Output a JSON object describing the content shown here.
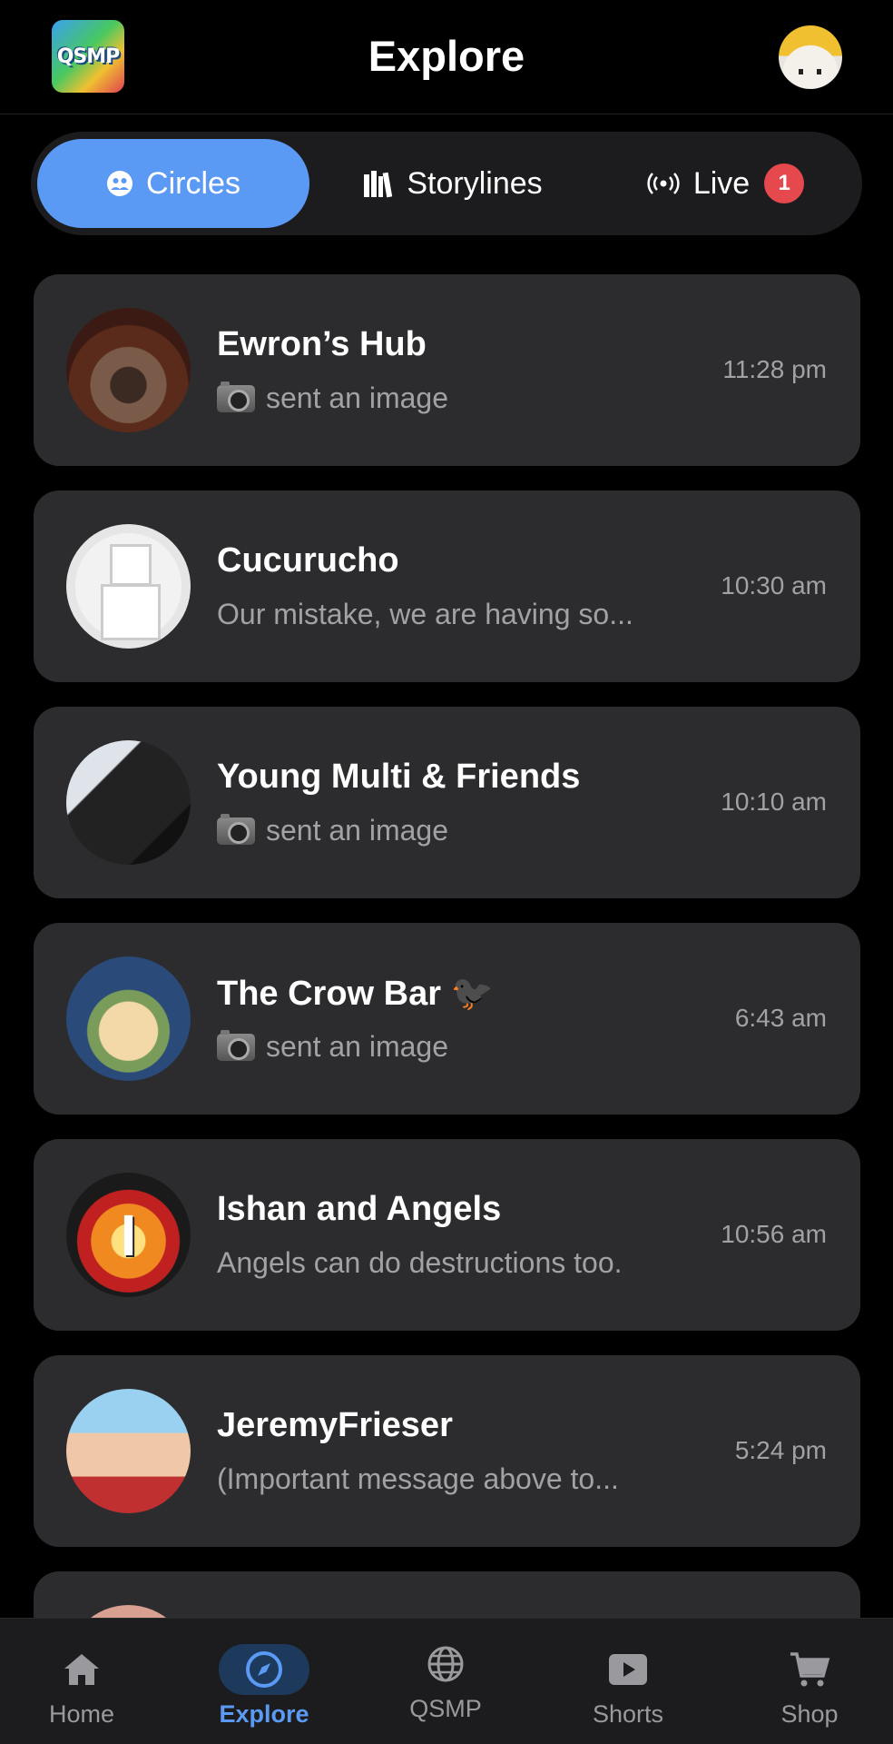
{
  "header": {
    "app_logo_text": "QSMP",
    "title": "Explore"
  },
  "segments": [
    {
      "label": "Circles",
      "icon": "people-icon",
      "active": true
    },
    {
      "label": "Storylines",
      "icon": "books-icon",
      "active": false
    },
    {
      "label": "Live",
      "icon": "broadcast-icon",
      "active": false,
      "badge": "1"
    }
  ],
  "circles": [
    {
      "name": "Ewron’s Hub",
      "preview": "sent an image",
      "has_image_icon": true,
      "time": "11:28 pm",
      "avatar": "red-panda-avatar"
    },
    {
      "name": "Cucurucho",
      "preview": "Our mistake, we are having so...",
      "has_image_icon": false,
      "time": "10:30 am",
      "avatar": "white-figure-avatar"
    },
    {
      "name": "Young Multi & Friends",
      "preview": "sent an image",
      "has_image_icon": true,
      "time": "10:10 am",
      "avatar": "person-photo-avatar"
    },
    {
      "name": "The Crow Bar 🐦‍⬛",
      "preview": "sent an image",
      "has_image_icon": true,
      "time": "6:43 am",
      "avatar": "anime-character-avatar"
    },
    {
      "name": "Ishan and Angels",
      "preview": "Angels can do destructions too.",
      "has_image_icon": false,
      "time": "10:56 am",
      "avatar": "letter-i-explosion-avatar"
    },
    {
      "name": "JeremyFrieser",
      "preview": "(Important message above to...",
      "has_image_icon": false,
      "time": "5:24 pm",
      "avatar": "person-sunglasses-avatar"
    }
  ],
  "bottom_nav": [
    {
      "label": "Home",
      "icon": "home-icon",
      "active": false
    },
    {
      "label": "Explore",
      "icon": "compass-icon",
      "active": true
    },
    {
      "label": "QSMP",
      "icon": "globe-icon",
      "active": false
    },
    {
      "label": "Shorts",
      "icon": "play-icon",
      "active": false
    },
    {
      "label": "Shop",
      "icon": "cart-icon",
      "active": false
    }
  ],
  "colors": {
    "accent": "#5b9af4",
    "card_bg": "#2c2c2e",
    "badge_red": "#e5484d"
  }
}
